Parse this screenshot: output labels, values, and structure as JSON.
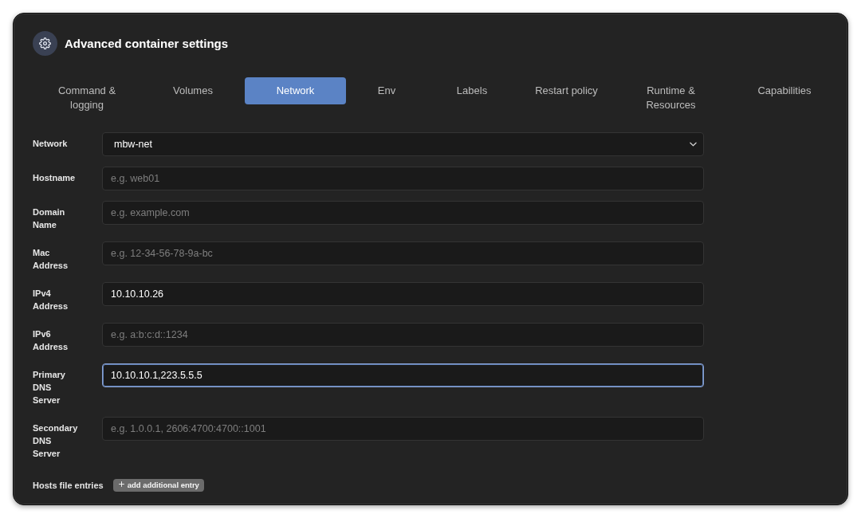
{
  "window": {
    "title": "Advanced container settings"
  },
  "tabs": [
    {
      "label": "Command & logging",
      "selected": false
    },
    {
      "label": "Volumes",
      "selected": false
    },
    {
      "label": "Network",
      "selected": true
    },
    {
      "label": "Env",
      "selected": false
    },
    {
      "label": "Labels",
      "selected": false
    },
    {
      "label": "Restart policy",
      "selected": false
    },
    {
      "label": "Runtime & Resources",
      "selected": false
    },
    {
      "label": "Capabilities",
      "selected": false
    }
  ],
  "form": {
    "fields": [
      {
        "kind": "select",
        "label": "Network",
        "value": "mbw-net",
        "focused": false
      },
      {
        "kind": "text",
        "label": "Hostname",
        "placeholder": "e.g. web01",
        "focused": false
      },
      {
        "kind": "text",
        "label": "Domain Name",
        "placeholder": "e.g. example.com",
        "focused": false
      },
      {
        "kind": "text",
        "label": "Mac Address",
        "placeholder": "e.g. 12-34-56-78-9a-bc",
        "focused": false
      },
      {
        "kind": "text",
        "label": "IPv4 Address",
        "value": "10.10.10.26",
        "focused": false
      },
      {
        "kind": "text",
        "label": "IPv6 Address",
        "placeholder": "e.g. a:b:c:d::1234",
        "focused": false
      },
      {
        "kind": "text",
        "label": "Primary DNS Server",
        "value": "10.10.10.1,223.5.5.5",
        "focused": true
      },
      {
        "kind": "text",
        "label": "Secondary DNS Server",
        "placeholder": "e.g. 1.0.0.1, 2606:4700:4700::1001",
        "focused": false
      }
    ],
    "hosts_file": {
      "label": "Hosts file entries",
      "button": "add additional entry"
    }
  }
}
